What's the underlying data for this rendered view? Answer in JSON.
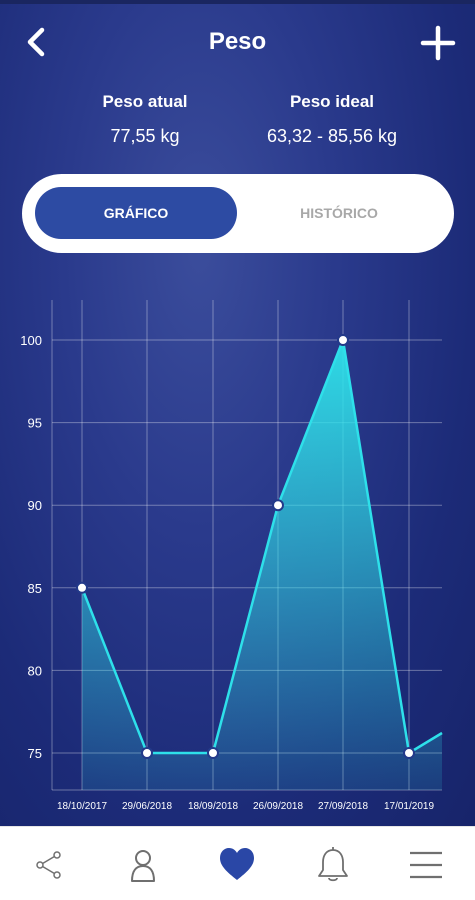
{
  "header": {
    "title": "Peso",
    "back_icon": "chevron-left-icon",
    "add_icon": "plus-icon"
  },
  "stats": {
    "current": {
      "label": "Peso atual",
      "value": "77,55 kg"
    },
    "ideal": {
      "label": "Peso ideal",
      "value": "63,32 - 85,56 kg"
    }
  },
  "tabs": [
    {
      "label": "GRÁFICO",
      "active": true
    },
    {
      "label": "HISTÓRICO",
      "active": false
    }
  ],
  "chart_data": {
    "type": "area",
    "categories": [
      "18/10/2017",
      "29/06/2018",
      "18/09/2018",
      "26/09/2018",
      "27/09/2018",
      "17/01/2019"
    ],
    "values": [
      85,
      75,
      75,
      90,
      100,
      75
    ],
    "ylim": [
      75,
      100
    ],
    "yticks": [
      100,
      95,
      90,
      85,
      80,
      75
    ],
    "grid": true,
    "line_color": "#2ee0ea",
    "title": "",
    "xlabel": "",
    "ylabel": ""
  },
  "bottom_nav": [
    {
      "icon": "share-icon"
    },
    {
      "icon": "user-icon"
    },
    {
      "icon": "heart-icon",
      "active": true
    },
    {
      "icon": "bell-icon"
    },
    {
      "icon": "menu-icon"
    }
  ],
  "colors": {
    "accent": "#2d4ba3",
    "nav_active": "#2a47a6",
    "nav_inactive": "#6f6f6f"
  }
}
